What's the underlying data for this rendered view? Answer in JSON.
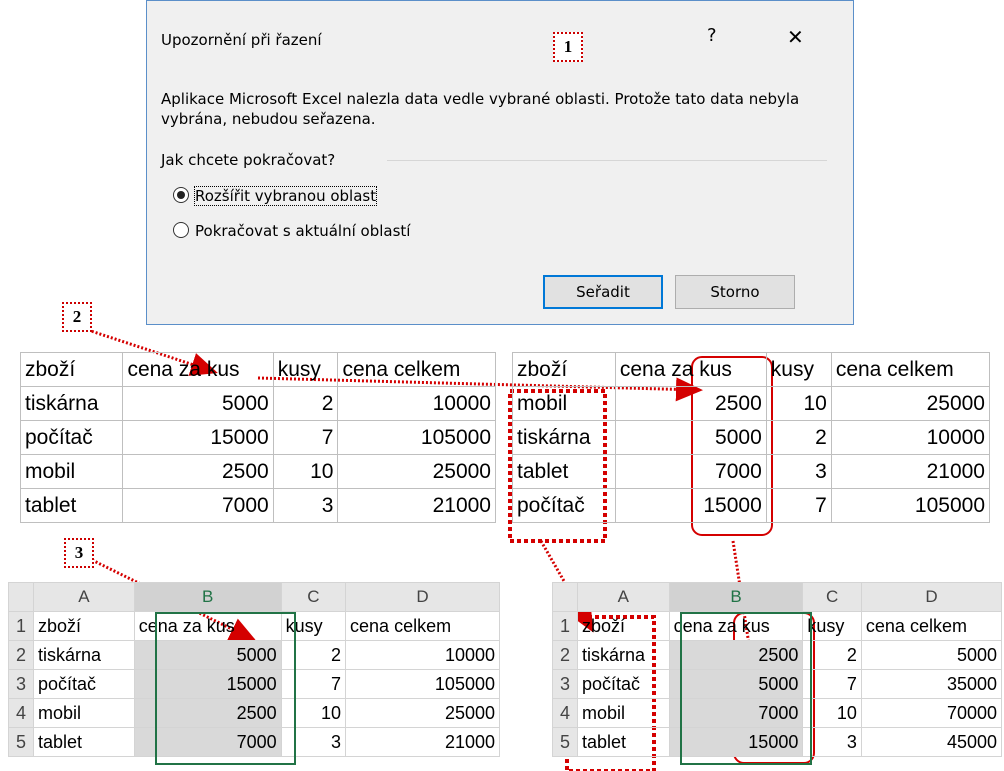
{
  "dialog": {
    "title": "Upozornění při řazení",
    "help": "?",
    "close": "✕",
    "message": "Aplikace Microsoft Excel nalezla data vedle vybrané oblasti. Protože tato data nebyla vybrána, nebudou seřazena.",
    "question": "Jak chcete pokračovat?",
    "option_expand": "Rozšířit vybranou oblast",
    "option_continue": "Pokračovat s aktuální oblastí",
    "sort_button": "Seřadit",
    "cancel_button": "Storno"
  },
  "callouts": [
    "1",
    "2",
    "3"
  ],
  "table_left": {
    "headers": [
      "zboží",
      "cena za kus",
      "kusy",
      "cena celkem"
    ],
    "rows": [
      [
        "tiskárna",
        "5000",
        "2",
        "10000"
      ],
      [
        "počítač",
        "15000",
        "7",
        "105000"
      ],
      [
        "mobil",
        "2500",
        "10",
        "25000"
      ],
      [
        "tablet",
        "7000",
        "3",
        "21000"
      ]
    ]
  },
  "table_right": {
    "headers": [
      "zboží",
      "cena za kus",
      "kusy",
      "cena celkem"
    ],
    "rows": [
      [
        "mobil",
        "2500",
        "10",
        "25000"
      ],
      [
        "tiskárna",
        "5000",
        "2",
        "10000"
      ],
      [
        "tablet",
        "7000",
        "3",
        "21000"
      ],
      [
        "počítač",
        "15000",
        "7",
        "105000"
      ]
    ]
  },
  "excel_left": {
    "col_headers": [
      "A",
      "B",
      "C",
      "D"
    ],
    "row_numbers": [
      "1",
      "2",
      "3",
      "4",
      "5"
    ],
    "rows": [
      [
        "zboží",
        "cena za kus",
        "kusy",
        "cena celkem"
      ],
      [
        "tiskárna",
        "5000",
        "2",
        "10000"
      ],
      [
        "počítač",
        "15000",
        "7",
        "105000"
      ],
      [
        "mobil",
        "2500",
        "10",
        "25000"
      ],
      [
        "tablet",
        "7000",
        "3",
        "21000"
      ]
    ]
  },
  "excel_right": {
    "col_headers": [
      "A",
      "B",
      "C",
      "D"
    ],
    "row_numbers": [
      "1",
      "2",
      "3",
      "4",
      "5"
    ],
    "rows": [
      [
        "zboží",
        "cena za kus",
        "kusy",
        "cena celkem"
      ],
      [
        "tiskárna",
        "2500",
        "2",
        "5000"
      ],
      [
        "počítač",
        "5000",
        "7",
        "35000"
      ],
      [
        "mobil",
        "7000",
        "10",
        "70000"
      ],
      [
        "tablet",
        "15000",
        "3",
        "45000"
      ]
    ]
  },
  "colors": {
    "annotation": "#d40000",
    "excel_selection": "#217346",
    "dialog_border": "#5b8fc9"
  }
}
